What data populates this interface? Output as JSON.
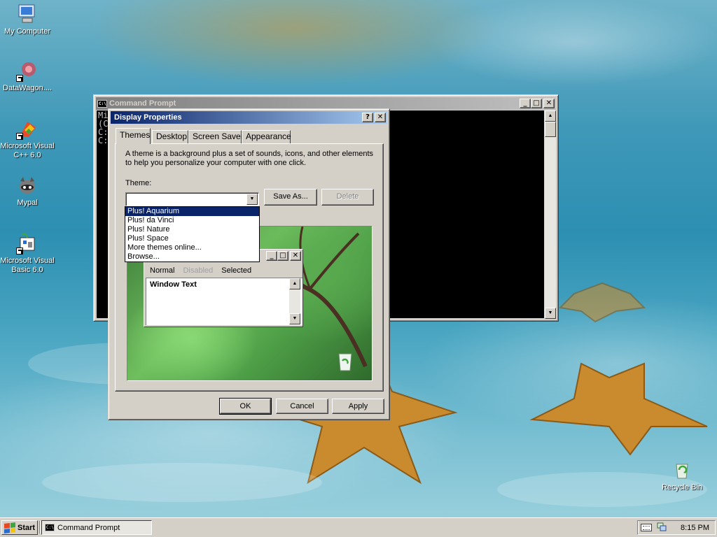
{
  "desktop": {
    "icons": [
      {
        "label": "My Computer",
        "icon": "my-computer-icon"
      },
      {
        "label": "DataWagon....",
        "icon": "datawagon-icon"
      },
      {
        "label": "Microsoft Visual C++ 6.0",
        "icon": "visual-cpp-icon"
      },
      {
        "label": "Mypal",
        "icon": "mypal-icon"
      },
      {
        "label": "Microsoft Visual Basic 6.0",
        "icon": "visual-basic-icon"
      },
      {
        "label": "Recycle Bin",
        "icon": "recycle-bin-icon"
      }
    ]
  },
  "cmd": {
    "title": "Command Prompt",
    "lines": [
      "Mi",
      "(C",
      "",
      "C:",
      "",
      "C:"
    ]
  },
  "display_properties": {
    "title": "Display Properties",
    "help_button": "?",
    "close_button": "✕",
    "tabs": [
      "Themes",
      "Desktop",
      "Screen Saver",
      "Appearance"
    ],
    "description": "A theme is a background plus a set of sounds, icons, and other elements to help you personalize your computer with one click.",
    "theme_label": "Theme:",
    "theme_value": "",
    "save_as": "Save As...",
    "delete": "Delete",
    "theme_options": [
      "Plus! Aquarium",
      "Plus! da Vinci",
      "Plus! Nature",
      "Plus! Space",
      "More themes online...",
      "Browse..."
    ],
    "highlighted_option": "Plus! Aquarium",
    "preview": {
      "tabs": [
        "Normal",
        "Disabled",
        "Selected"
      ],
      "window_text": "Window Text"
    },
    "ok": "OK",
    "cancel": "Cancel",
    "apply": "Apply"
  },
  "taskbar": {
    "start_label": "Start",
    "task_label": "Command Prompt",
    "clock": "8:15 PM"
  },
  "colors": {
    "title_active": "#0a246a",
    "title_inactive": "#808080",
    "face": "#d4d0c8",
    "highlight": "#0a246a"
  }
}
